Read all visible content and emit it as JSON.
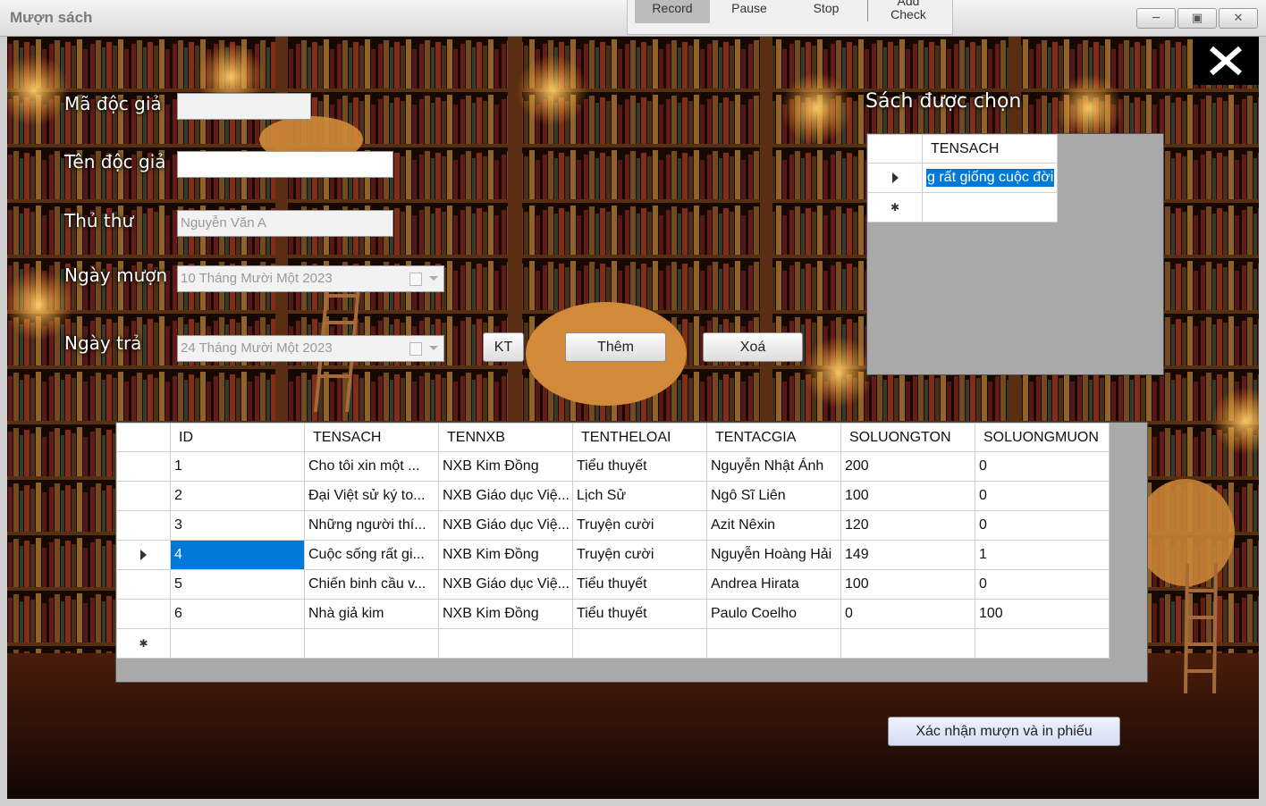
{
  "window": {
    "title": "Mượn sách",
    "min_icon": "minimize-icon",
    "max_icon": "maximize-icon",
    "close_icon": "close-icon"
  },
  "recorder": {
    "record": "Record",
    "pause": "Pause",
    "stop": "Stop",
    "add_check": "Add\nCheck"
  },
  "form": {
    "ma_doc_gia": {
      "label": "Mã độc giả",
      "value": ""
    },
    "ten_doc_gia": {
      "label": "Tên độc giả",
      "value": ""
    },
    "thu_thu": {
      "label": "Thủ thư",
      "value": "Nguyễn Văn A"
    },
    "ngay_muon": {
      "label": "Ngày mượn",
      "value": "10 Tháng Mười Một 2023"
    },
    "ngay_tra": {
      "label": "Ngày trả",
      "value": "24 Tháng Mười Một 2023"
    },
    "kt_button": "KT",
    "them_button": "Thêm",
    "xoa_button": "Xoá",
    "confirm_button": "Xác nhận mượn và in phiếu"
  },
  "selected": {
    "title": "Sách được chọn",
    "header": "TENSACH",
    "rows": [
      "g rất giống cuộc đời"
    ]
  },
  "books": {
    "columns": [
      "ID",
      "TENSACH",
      "TENNXB",
      "TENTHELOAI",
      "TENTACGIA",
      "SOLUONGTON",
      "SOLUONGMUON"
    ],
    "rows": [
      [
        "1",
        "Cho tôi xin một ...",
        "NXB Kim Đồng",
        "Tiểu thuyết",
        "Nguyễn Nhật Ánh",
        "200",
        "0"
      ],
      [
        "2",
        "Đại Việt sử ký to...",
        "NXB Giáo dục Việ...",
        "Lịch Sử",
        "Ngô Sĩ Liên",
        "100",
        "0"
      ],
      [
        "3",
        "Những người thí...",
        "NXB Giáo dục Việ...",
        "Truyện cười",
        "Azit Nêxin",
        "120",
        "0"
      ],
      [
        "4",
        "Cuộc sống rất gi...",
        "NXB Kim Đồng",
        "Truyện cười",
        "Nguyễn Hoàng Hải",
        "149",
        "1"
      ],
      [
        "5",
        "Chiến binh cầu v...",
        "NXB Giáo dục Việ...",
        "Tiểu thuyết",
        "Andrea Hirata",
        "100",
        "0"
      ],
      [
        "6",
        "Nhà giả kim",
        "NXB Kim Đồng",
        "Tiểu thuyết",
        "Paulo Coelho",
        "0",
        "100"
      ]
    ],
    "current_row": 3
  },
  "colors": {
    "selection": "#0078d7",
    "grid_bg": "#a9a9a9",
    "scene_bg": "#2a120a"
  }
}
